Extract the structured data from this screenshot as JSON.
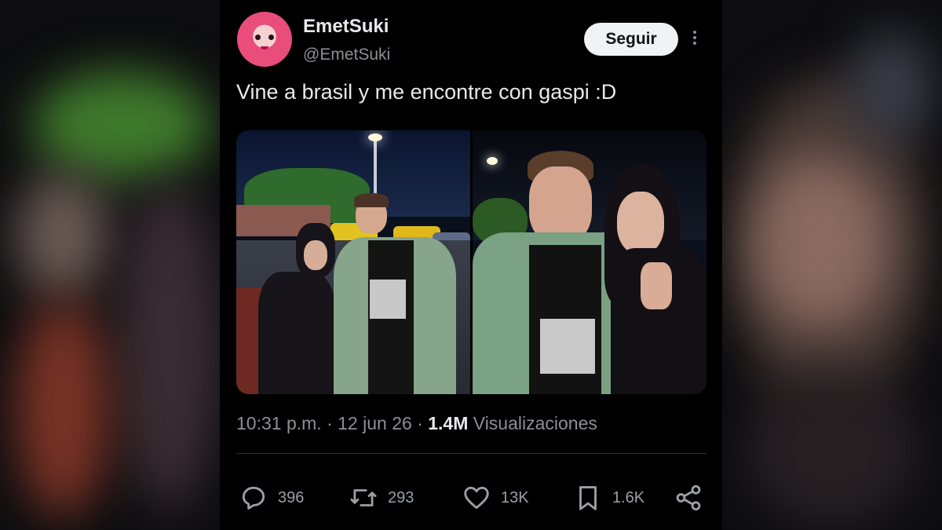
{
  "author": {
    "display_name": "EmetSuki",
    "handle": "@EmetSuki"
  },
  "follow_label": "Seguir",
  "tweet": {
    "text": "Vine a brasil y me encontre con gaspi :D",
    "images": [
      {
        "description_icon": "photo-icon"
      },
      {
        "description_icon": "photo-icon"
      }
    ]
  },
  "meta": {
    "time": "10:31 p.m.",
    "separator": " · ",
    "date": "12 jun 26",
    "views_count": "1.4M",
    "views_label": "Visualizaciones"
  },
  "actions": {
    "replies": "396",
    "retweets": "293",
    "likes": "13K",
    "bookmarks": "1.6K"
  },
  "colors": {
    "background": "#000000",
    "text_primary": "#e7e9ea",
    "text_secondary": "#8b8f94",
    "follow_button_bg": "#eff3f4"
  }
}
